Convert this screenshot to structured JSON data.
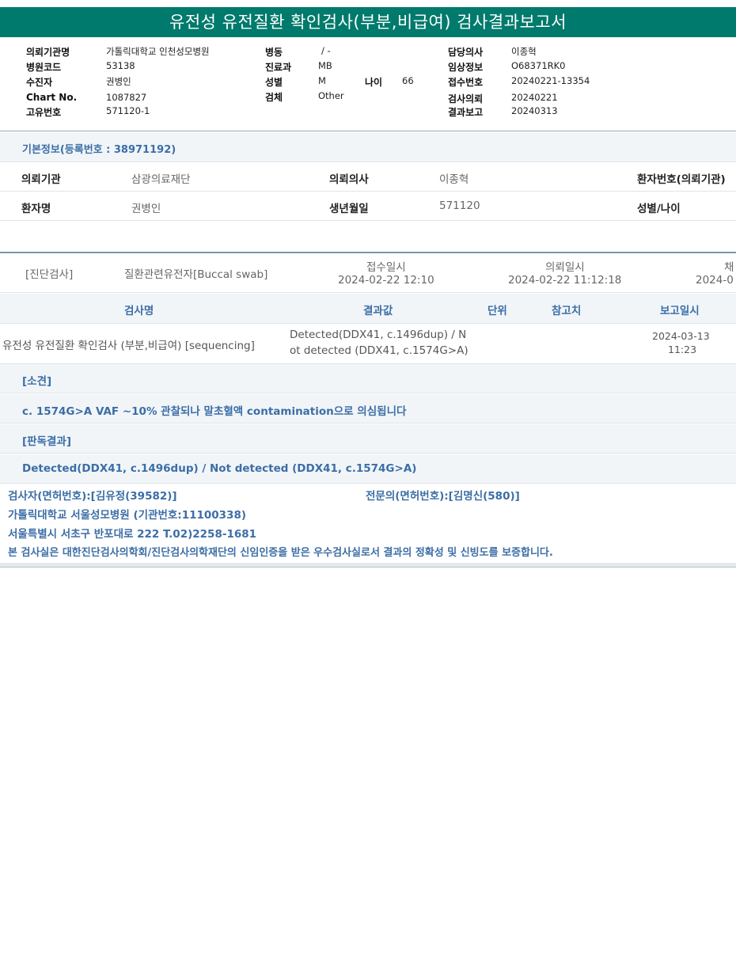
{
  "report": {
    "title": "유전성 유전질환 확인검사(부분,비급여) 검사결과보고서"
  },
  "header": {
    "institution_label": "의뢰기관명",
    "institution_value": "가톨릭대학교 인천성모병원",
    "hospital_code_label": "병원코드",
    "hospital_code_value": "53138",
    "patient_label": "수진자",
    "patient_value": "권병인",
    "chart_label": "Chart No.",
    "chart_value": "1087827",
    "unique_label": "고유번호",
    "unique_value": "571120-1",
    "ward_label": "병동",
    "ward_value": "/ -",
    "dept_label": "진료과",
    "dept_value": "MB",
    "sex_label": "성별",
    "sex_value": "M",
    "age_label": "나이",
    "age_value": "66",
    "specimen_label": "검체",
    "specimen_value": "Other",
    "doctor_label": "담당의사",
    "doctor_value": "이종혁",
    "clinical_label": "임상정보",
    "clinical_value": "O68371RK0",
    "receipt_label": "접수번호",
    "receipt_value": "20240221-13354",
    "request_label": "검사의뢰",
    "request_value": "20240221",
    "report_label": "결과보고",
    "report_value": "20240313"
  },
  "basic_info": {
    "heading": "기본정보(등록번호 : 38971192)",
    "req_inst_label": "의뢰기관",
    "req_inst_value": "삼광의료재단",
    "req_doc_label": "의뢰의사",
    "req_doc_value": "이종혁",
    "patient_no_label": "환자번호(의뢰기관)",
    "patient_name_label": "환자명",
    "patient_name_value": "권병인",
    "dob_label": "생년월일",
    "dob_value": "571120",
    "sex_age_label": "성별/나이"
  },
  "test_info": {
    "category": "[진단검사]",
    "test_type": "질환관련유전자[Buccal swab]",
    "received_label": "접수일시",
    "received_value": "2024-02-22 12:10",
    "requested_label": "의뢰일시",
    "requested_value": "2024-02-22 11:12:18",
    "collected_label": "채",
    "collected_value": "2024-0"
  },
  "results_table": {
    "headers": {
      "name": "검사명",
      "result": "결과값",
      "unit": "단위",
      "ref": "참고치",
      "date": "보고일시"
    },
    "row": {
      "name": "유전성 유전질환 확인검사 (부분,비급여) [sequencing]",
      "result_line1": "Detected(DDX41, c.1496dup) / N",
      "result_line2": "ot detected (DDX41, c.1574G>A)",
      "date_line1": "2024-03-13",
      "date_line2": "11:23"
    }
  },
  "findings": {
    "heading": "[소견]",
    "text": "c. 1574G>A VAF ~10% 관찰되나 말초혈액 contamination으로 의심됩니다"
  },
  "interpretation": {
    "heading": "[판독결과]",
    "text": "Detected(DDX41, c.1496dup) / Not detected (DDX41, c.1574G>A)"
  },
  "footer": {
    "examiner": "검사자(면허번호):[김유정(39582)]",
    "specialist": "전문의(면허번호):[김명신(580)]",
    "hospital": "가톨릭대학교 서울성모병원 (기관번호:11100338)",
    "address": "서울특별시 서초구 반포대로 222 T.02)2258-1681",
    "certification": "본 검사실은 대한진단검사의학회/진단검사의학재단의 신임인증을 받은 우수검사실로서 결과의 정확성 및 신빙도를 보증합니다."
  }
}
